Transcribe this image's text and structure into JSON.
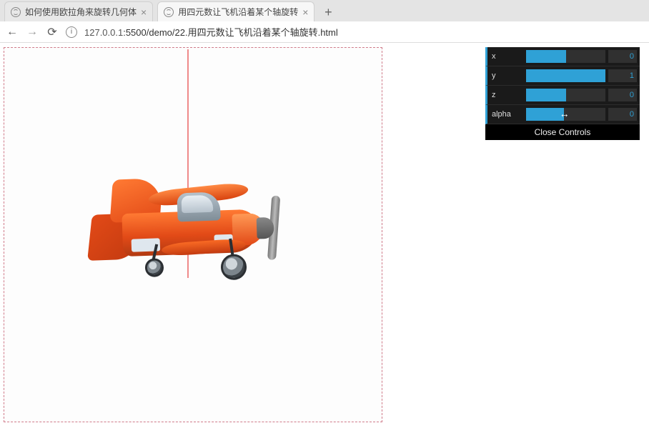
{
  "browser": {
    "tabs": [
      {
        "title": "如何使用欧拉角来旋转几何体",
        "active": false
      },
      {
        "title": "用四元数让飞机沿着某个轴旋转",
        "active": true
      }
    ],
    "new_tab_glyph": "+",
    "close_glyph": "×",
    "nav": {
      "back_glyph": "←",
      "forward_glyph": "→",
      "reload_glyph": "⟳",
      "info_glyph": "i"
    },
    "url_host": "127.0.0.1",
    "url_port": ":5500",
    "url_path": "/demo/22.用四元数让飞机沿着某个轴旋转.html"
  },
  "scene": {
    "description": "orange biplane model with vertical red axis line",
    "axis_color": "#ef8a8a"
  },
  "gui": {
    "rows": [
      {
        "name": "x",
        "value": 0,
        "fill_pct": 50
      },
      {
        "name": "y",
        "value": 1,
        "fill_pct": 100
      },
      {
        "name": "z",
        "value": 0,
        "fill_pct": 50
      },
      {
        "name": "alpha",
        "value": 0,
        "fill_pct": 48
      }
    ],
    "close_label": "Close Controls",
    "resize_cursor_glyph": "↔"
  }
}
